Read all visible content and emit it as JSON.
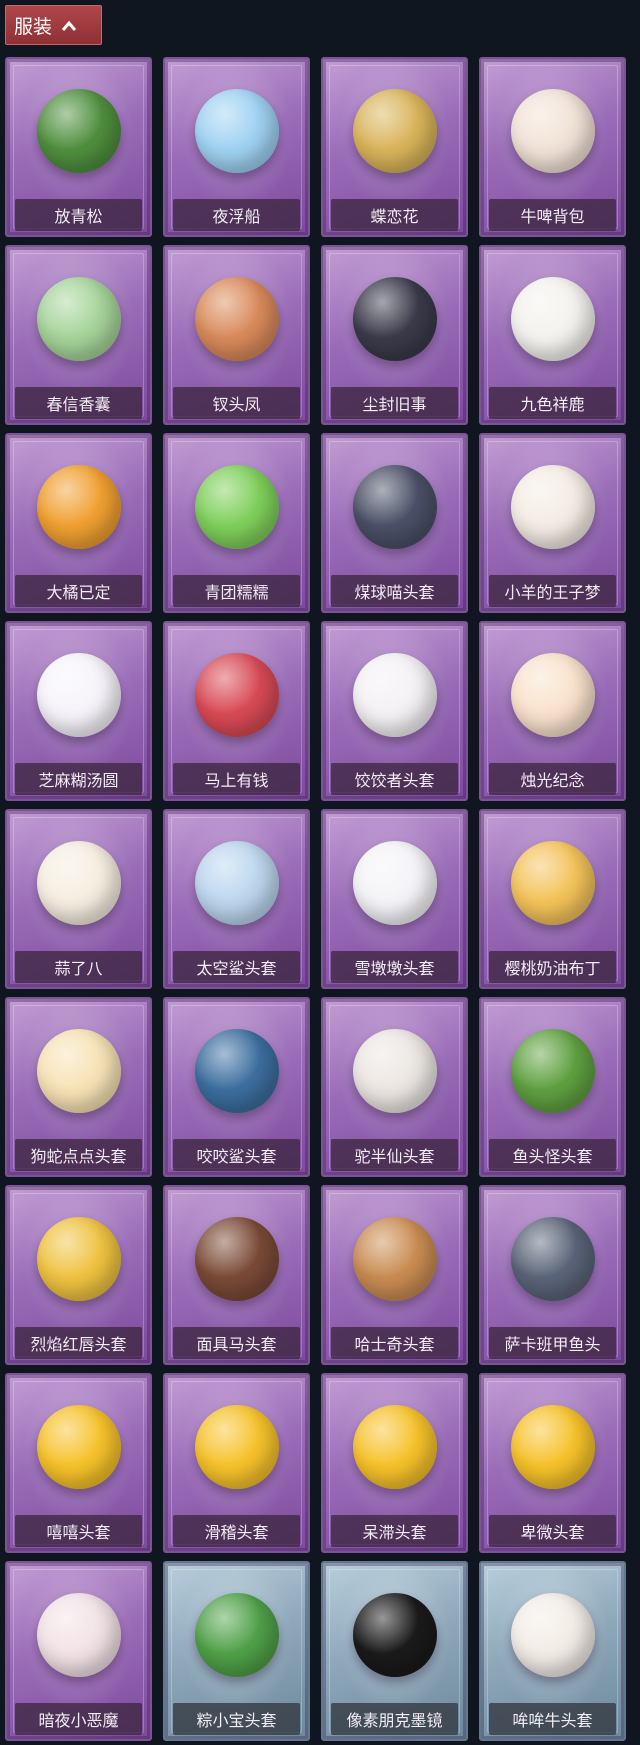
{
  "header": {
    "title": "服装",
    "toggle_icon": "chevron-up-icon"
  },
  "items": [
    {
      "label": "放青松",
      "icon": "bonsai-pine",
      "color": "#4f8f3e"
    },
    {
      "label": "夜浮船",
      "icon": "jellyfish",
      "color": "#9fd2f2"
    },
    {
      "label": "蝶恋花",
      "icon": "flower-wreath",
      "color": "#d9b45a"
    },
    {
      "label": "牛啤背包",
      "icon": "cow-beer-mug",
      "color": "#f1e2d6"
    },
    {
      "label": "春信香囊",
      "icon": "sachet",
      "color": "#a6d49a"
    },
    {
      "label": "钗头凤",
      "icon": "phoenix-crown-doll",
      "color": "#d98a5a"
    },
    {
      "label": "尘封旧事",
      "icon": "chibi-figure",
      "color": "#3a3a4a"
    },
    {
      "label": "九色祥鹿",
      "icon": "deer",
      "color": "#f4f2ee"
    },
    {
      "label": "大橘已定",
      "icon": "orange",
      "color": "#f0a030"
    },
    {
      "label": "青团糯糯",
      "icon": "green-rice-ball",
      "color": "#7fcf5a"
    },
    {
      "label": "煤球喵头套",
      "icon": "cat-head",
      "color": "#4a5066"
    },
    {
      "label": "小羊的王子梦",
      "icon": "sheep-head",
      "color": "#f3ece4"
    },
    {
      "label": "芝麻糊汤圆",
      "icon": "rice-dumpling",
      "color": "#f6f4fa"
    },
    {
      "label": "马上有钱",
      "icon": "red-horse",
      "color": "#d84a55"
    },
    {
      "label": "饺饺者头套",
      "icon": "cloud-head",
      "color": "#f4f1f4"
    },
    {
      "label": "烛光纪念",
      "icon": "candle",
      "color": "#f8e2cc"
    },
    {
      "label": "蒜了八",
      "icon": "garlic",
      "color": "#f5eee0"
    },
    {
      "label": "太空鲨头套",
      "icon": "space-shark",
      "color": "#bcd6ee"
    },
    {
      "label": "雪墩墩头套",
      "icon": "snowman-head",
      "color": "#f4f4f8"
    },
    {
      "label": "樱桃奶油布丁",
      "icon": "pudding",
      "color": "#f3c35a"
    },
    {
      "label": "狗蛇点点头套",
      "icon": "dog-snake-head",
      "color": "#f6e3b5"
    },
    {
      "label": "咬咬鲨头套",
      "icon": "shark-head",
      "color": "#3c6e9e"
    },
    {
      "label": "驼半仙头套",
      "icon": "bear-head",
      "color": "#ebe6e2"
    },
    {
      "label": "鱼头怪头套",
      "icon": "fish-head",
      "color": "#5fa040"
    },
    {
      "label": "烈焰红唇头套",
      "icon": "pikachu-head",
      "color": "#efc340"
    },
    {
      "label": "面具马头套",
      "icon": "horse-mask",
      "color": "#7a4a36"
    },
    {
      "label": "哈士奇头套",
      "icon": "husky-head",
      "color": "#c98c52"
    },
    {
      "label": "萨卡班甲鱼头",
      "icon": "fish-plush",
      "color": "#5a6478"
    },
    {
      "label": "嘻嘻头套",
      "icon": "grin-emoji",
      "color": "#f6c22a"
    },
    {
      "label": "滑稽头套",
      "icon": "smirk-emoji",
      "color": "#f6c22a"
    },
    {
      "label": "呆滞头套",
      "icon": "stare-emoji",
      "color": "#f6c22a"
    },
    {
      "label": "卑微头套",
      "icon": "humble-emoji",
      "color": "#f6c22a"
    },
    {
      "label": "暗夜小恶魔",
      "icon": "imp-figure",
      "color": "#f2e2e6"
    },
    {
      "label": "粽小宝头套",
      "icon": "zongzi-head",
      "color": "#4fa048",
      "theme": "blue"
    },
    {
      "label": "像素朋克墨镜",
      "icon": "pixel-sunglasses",
      "color": "#1a1a1a",
      "theme": "blue"
    },
    {
      "label": "哞哞牛头套",
      "icon": "cow-head",
      "color": "#f2ece6",
      "theme": "blue"
    }
  ]
}
